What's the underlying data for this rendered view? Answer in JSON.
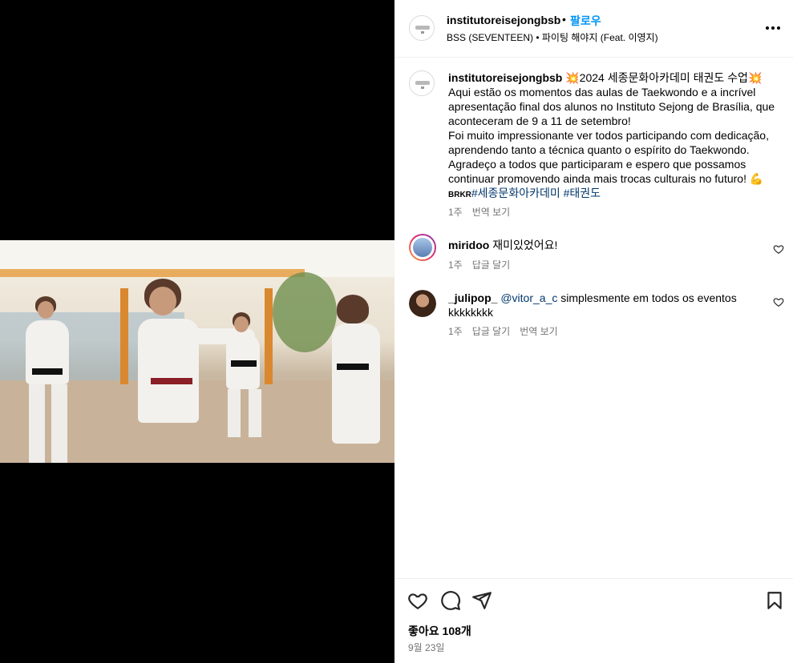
{
  "post": {
    "username": "institutoreisejongbsb",
    "dot": "•",
    "follow_label": "팔로우",
    "audio": "BSS (SEVENTEEN) • 파이팅 해야지 (Feat. 이영지)"
  },
  "caption": {
    "username": "institutoreisejongbsb",
    "star_left": "💥",
    "title": "2024 세종문화아카데미 태권도 수업",
    "star_right": "💥",
    "lines": [
      "Aqui estão os momentos das aulas de Taekwondo e a incrível",
      "apresentação final dos alunos no Instituto Sejong de Brasília, que",
      "aconteceram de 9 a 11 de setembro!",
      "Foi muito impressionante ver todos participando com dedicação,",
      "aprendendo tanto a técnica quanto o espírito do Taekwondo.",
      "Agradeço a todos que participaram e espero que possamos",
      "continuar promovendo ainda mais trocas culturais no futuro! 💪"
    ],
    "brkr": "BRKR",
    "hashtags": "#세종문화아카데미 #태권도",
    "time": "1주",
    "translate": "번역 보기"
  },
  "comments": [
    {
      "username": "miridoo",
      "text": "재미있었어요!",
      "time": "1주",
      "reply": "답글 달기"
    },
    {
      "username": "_julipop_",
      "mention": "@vitor_a_c",
      "text": "simplesmente em todos os eventos",
      "text2": "kkkkkkkk",
      "time": "1주",
      "reply": "답글 달기",
      "translate": "번역 보기"
    }
  ],
  "footer": {
    "likes": "좋아요 108개",
    "date": "9월 23일"
  },
  "icons": {
    "more": "more-horizontal-icon",
    "like": "heart-icon",
    "comment": "comment-icon",
    "share": "share-icon",
    "save": "bookmark-icon"
  },
  "colors": {
    "accent": "#0095f6",
    "hashtag": "#00376b",
    "muted": "#737373"
  }
}
